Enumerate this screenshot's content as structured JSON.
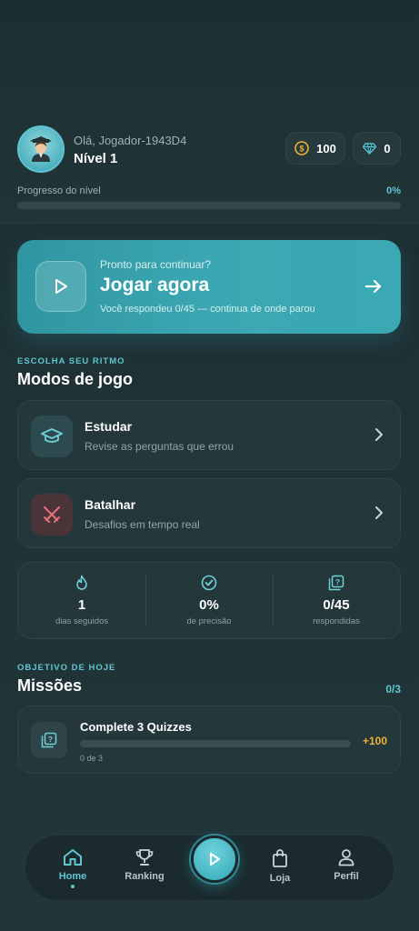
{
  "header": {
    "greeting": "Olá, Jogador-1943D4",
    "level": "Nível 1",
    "coins": "100",
    "gems": "0",
    "progress_label": "Progresso do nível",
    "progress_percent": "0%",
    "progress_value": 0
  },
  "play_card": {
    "subtitle": "Pronto para continuar?",
    "title": "Jogar agora",
    "description": "Você respondeu 0/45 — continua de onde parou"
  },
  "modes_section": {
    "kicker": "ESCOLHA SEU RITMO",
    "title": "Modos de jogo",
    "modes": [
      {
        "title": "Estudar",
        "description": "Revise as perguntas que errou",
        "icon": "graduation-cap-icon"
      },
      {
        "title": "Batalhar",
        "description": "Desafios em tempo real",
        "icon": "crossed-swords-icon"
      }
    ]
  },
  "stats": [
    {
      "value": "1",
      "label": "dias seguidos",
      "icon": "flame-icon"
    },
    {
      "value": "0%",
      "label": "de precisão",
      "icon": "check-circle-icon"
    },
    {
      "value": "0/45",
      "label": "respondidas",
      "icon": "question-cards-icon"
    }
  ],
  "missions_section": {
    "kicker": "OBJETIVO DE HOJE",
    "title": "Missões",
    "count": "0/3",
    "missions": [
      {
        "title": "Complete 3 Quizzes",
        "progress_text": "0 de 3",
        "progress_value": 0,
        "reward": "+100"
      }
    ]
  },
  "nav": {
    "items": [
      {
        "label": "Home",
        "icon": "home-icon",
        "active": true
      },
      {
        "label": "Ranking",
        "icon": "trophy-icon"
      },
      {
        "label": "Loja",
        "icon": "shopping-bag-icon"
      },
      {
        "label": "Perfil",
        "icon": "user-icon"
      }
    ]
  },
  "colors": {
    "accent": "#5fc6d2",
    "background": "#1f3236",
    "card": "#24373b",
    "reward": "#f2b134",
    "battle_icon": "#e0707a"
  }
}
